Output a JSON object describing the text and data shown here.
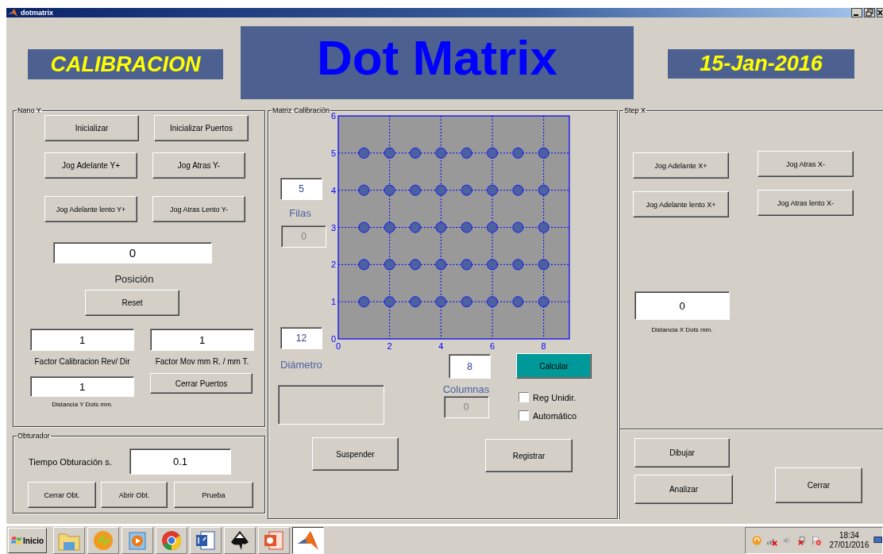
{
  "window": {
    "title": "dotmatrix"
  },
  "header": {
    "mode": "CALIBRACION",
    "title": "Dot Matrix",
    "date": "15-Jan-2016"
  },
  "nano_y": {
    "title": "Nano Y",
    "buttons": [
      "Inicializar",
      "Inicializar Puertos",
      "Jog Adelante Y+",
      "Jog Atras Y-",
      "Jog Adelante lento Y+",
      "Jog Atras Lento Y-"
    ],
    "position_value": "0",
    "position_label": "Posición",
    "reset": "Reset",
    "factor_calibracion": {
      "value": "1",
      "label": "Factor Calibracion Rev/ Dir"
    },
    "factor_mov": {
      "value": "1",
      "label": "Factor Mov mm R. / mm T."
    },
    "distancia_y": {
      "value": "1",
      "label": "Distancia Y Dots mm."
    },
    "cerrar_puertos": "Cerrar Puertos"
  },
  "obturador": {
    "title": "Obturador",
    "label": "Tiempo Obturación s.",
    "value": "0.1",
    "buttons": [
      "Cerrar Obt.",
      "Abrir Obt.",
      "Prueba"
    ]
  },
  "matriz": {
    "title": "Matriz Calibración",
    "filas": {
      "value": "5",
      "disabled": false
    },
    "filas_label": "Filas",
    "filas_count": {
      "value": "0",
      "disabled": true
    },
    "diametro": {
      "value": "12",
      "disabled": false
    },
    "diametro_label": "Diámetro",
    "columnas": {
      "value": "8",
      "disabled": false
    },
    "columnas_label": "Columnas",
    "columnas_count": {
      "value": "0",
      "disabled": true
    },
    "calcular": "Calcular",
    "checkboxes": [
      {
        "label": "Reg Unidir.",
        "checked": false
      },
      {
        "label": "Automático",
        "checked": false
      }
    ],
    "buttons": [
      "Suspender",
      "Registrar"
    ],
    "chart_data": {
      "type": "scatter",
      "x": [
        1,
        2,
        3,
        4,
        5,
        6,
        7,
        8,
        1,
        2,
        3,
        4,
        5,
        6,
        7,
        8,
        1,
        2,
        3,
        4,
        5,
        6,
        7,
        8,
        1,
        2,
        3,
        4,
        5,
        6,
        7,
        8,
        1,
        2,
        3,
        4,
        5,
        6,
        7,
        8
      ],
      "series": [
        {
          "color": "#4c62a0",
          "values": [
            5,
            5,
            5,
            5,
            5,
            5,
            5,
            5,
            4,
            4,
            4,
            4,
            4,
            4,
            4,
            4,
            3,
            3,
            3,
            3,
            3,
            3,
            3,
            3,
            2,
            2,
            2,
            2,
            2,
            2,
            2,
            2,
            1,
            1,
            1,
            1,
            1,
            1,
            1,
            1
          ]
        }
      ],
      "grid": true,
      "xlim": [
        0,
        9
      ],
      "ylim": [
        0,
        6
      ],
      "xticks": [
        0,
        2,
        4,
        6,
        8
      ],
      "yticks": [
        0,
        1,
        2,
        3,
        4,
        5,
        6
      ]
    }
  },
  "step_x": {
    "title": "Step X",
    "buttons": [
      "Jog Adelante X+",
      "Jog Atras X-",
      "Jog Adelante lento X+",
      "Jog Atras lento X-"
    ],
    "distancia_x": {
      "value": "0",
      "label": "Distancia X Dots mm."
    }
  },
  "actions": [
    "Dibujar",
    "Analizar",
    "Cerrar"
  ],
  "taskbar": {
    "start": "Inicio",
    "time": "18:34",
    "date": "27/01/2016"
  }
}
